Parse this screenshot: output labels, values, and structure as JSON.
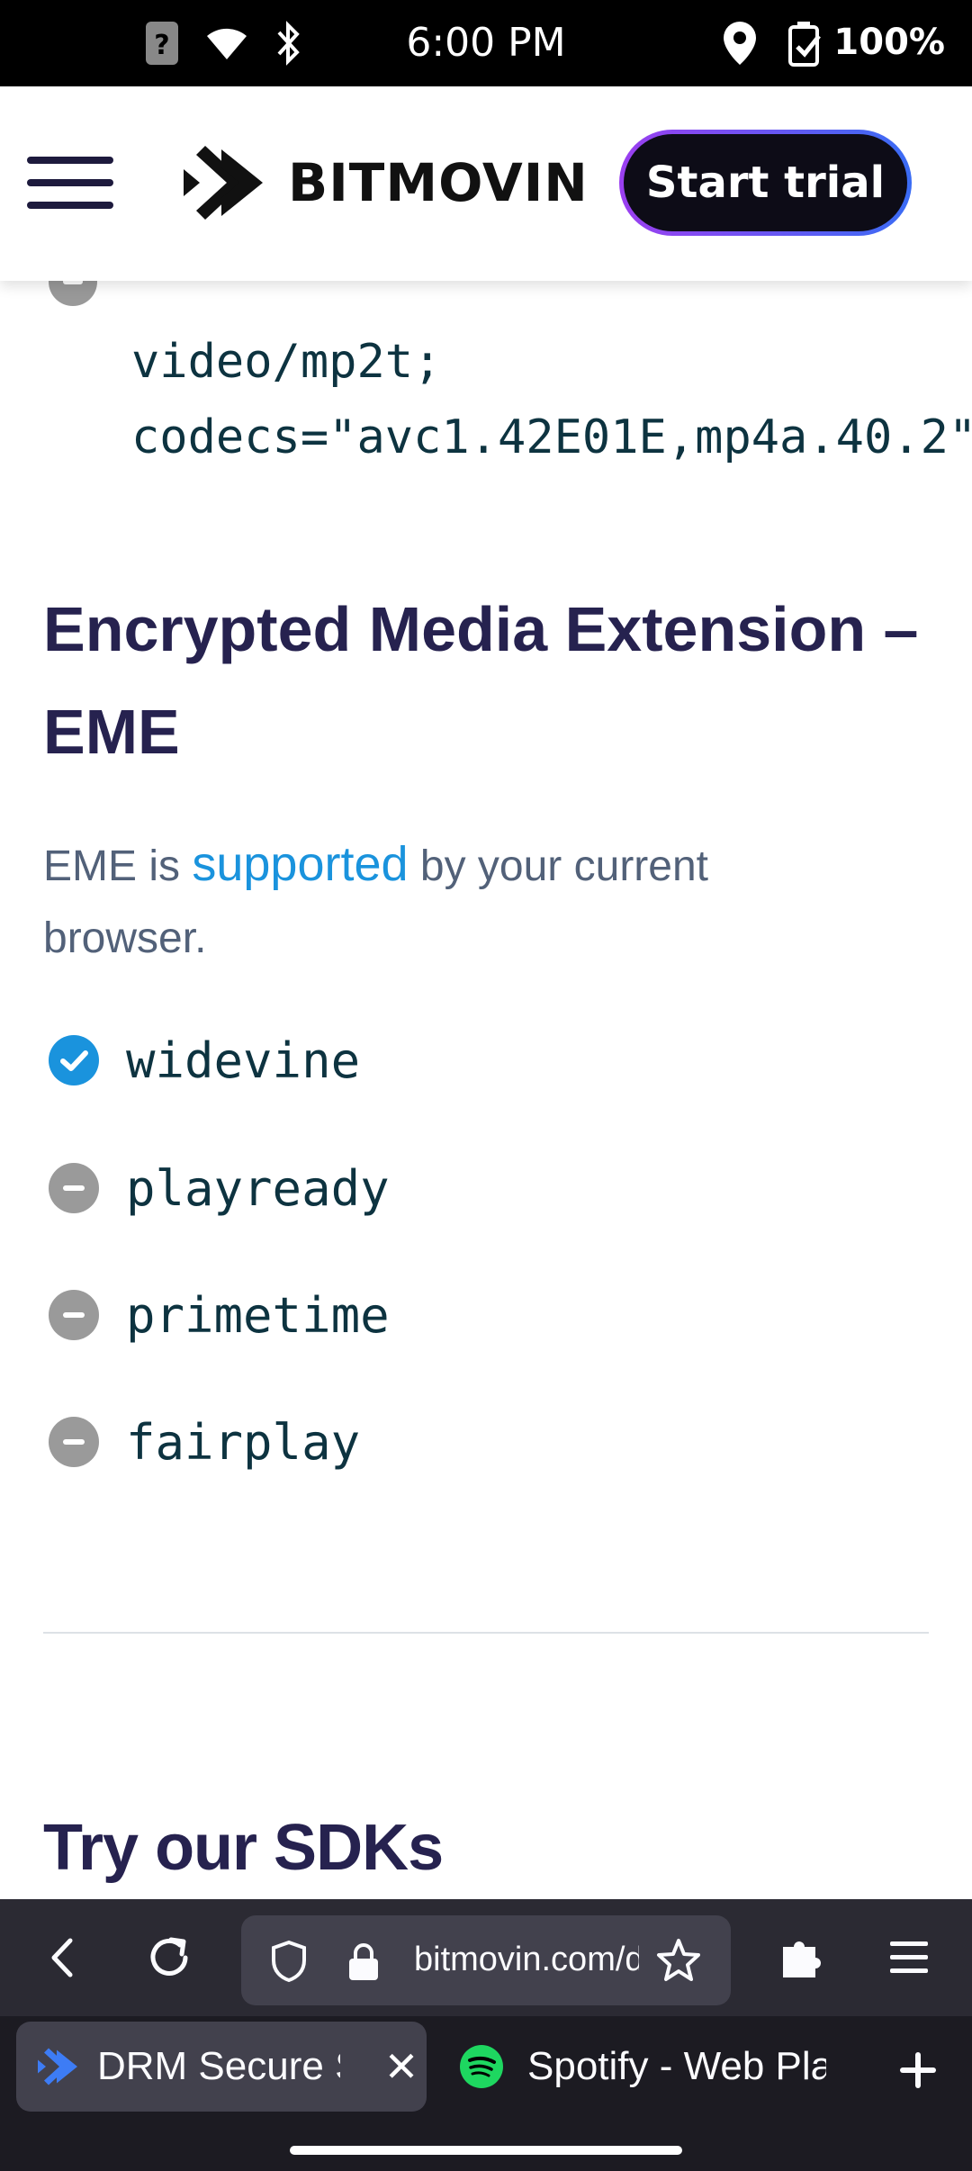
{
  "status_bar": {
    "time": "6:00 PM",
    "battery": "100%"
  },
  "header": {
    "logo_text": "BITMOVIN",
    "cta_label": "Start trial"
  },
  "mime": {
    "line1": "video/mp2t;",
    "line2": "codecs=\"avc1.42E01E,mp4a.40.2\""
  },
  "eme": {
    "title": "Encrypted Media Extension – EME",
    "text_prefix": "EME is ",
    "link_text": "supported",
    "text_suffix": " by your current browser.",
    "items": [
      {
        "label": "widevine",
        "supported": true
      },
      {
        "label": "playready",
        "supported": false
      },
      {
        "label": "primetime",
        "supported": false
      },
      {
        "label": "fairplay",
        "supported": false
      }
    ]
  },
  "sdk": {
    "title": "Try our SDKs"
  },
  "browser": {
    "url": "bitmovin.com/demos/drm",
    "tabs": [
      {
        "title": "DRM Secure Streaming"
      },
      {
        "title": "Spotify - Web Player"
      }
    ]
  },
  "colors": {
    "heading": "#26224f",
    "link": "#1a93dd",
    "toolbar": "#2b2a33",
    "tabstrip": "#1c1b22"
  }
}
